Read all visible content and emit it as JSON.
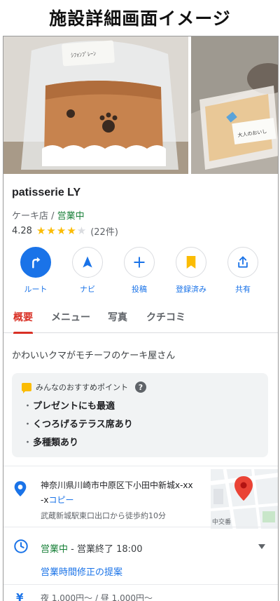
{
  "page_heading": "施設詳細画面イメージ",
  "photos": {
    "main_tag": "ｼﾌｫﾝﾌﾟﾚｰﾝ",
    "side_tag": "大人のおいし"
  },
  "shop": {
    "name": "patisserie LY",
    "category": "ケーキ店",
    "separator": " / ",
    "status": "営業中",
    "rating": "4.28",
    "rating_value": 4.28,
    "review_count": "(22件)"
  },
  "actions": [
    {
      "label": "ルート",
      "icon": "route-turn-icon"
    },
    {
      "label": "ナビ",
      "icon": "navigation-arrow-icon"
    },
    {
      "label": "投稿",
      "icon": "plus-icon"
    },
    {
      "label": "登録済み",
      "icon": "bookmark-icon"
    },
    {
      "label": "共有",
      "icon": "share-icon"
    }
  ],
  "tabs": [
    {
      "label": "概要",
      "active": true
    },
    {
      "label": "メニュー",
      "active": false
    },
    {
      "label": "写真",
      "active": false
    },
    {
      "label": "クチコミ",
      "active": false
    }
  ],
  "description": "かわいいクマがモチーフのケーキ屋さん",
  "recommend": {
    "title": "みんなのおすすめポイント",
    "help": "?",
    "bullet": "・",
    "items": [
      "プレゼントにも最適",
      "くつろげるテラス席あり",
      "多種類あり"
    ]
  },
  "address": {
    "line1": "神奈川県川崎市中原区下小田中新城x-xx",
    "line2": "-x",
    "copy": "コピー",
    "access": "武蔵新城駅東口出口から徒歩約10分",
    "map_label": "中交番"
  },
  "hours": {
    "status": "営業中",
    "separator": " - ",
    "closing": "営業終了 18:00",
    "suggest": "営業時間修正の提案"
  },
  "price": {
    "icon": "¥",
    "text": "夜 1,000円～ / 昼 1,000円～"
  },
  "colors": {
    "accent": "#1a73e8",
    "open": "#188038",
    "tab_active": "#d93025",
    "star": "#fbbc04"
  }
}
